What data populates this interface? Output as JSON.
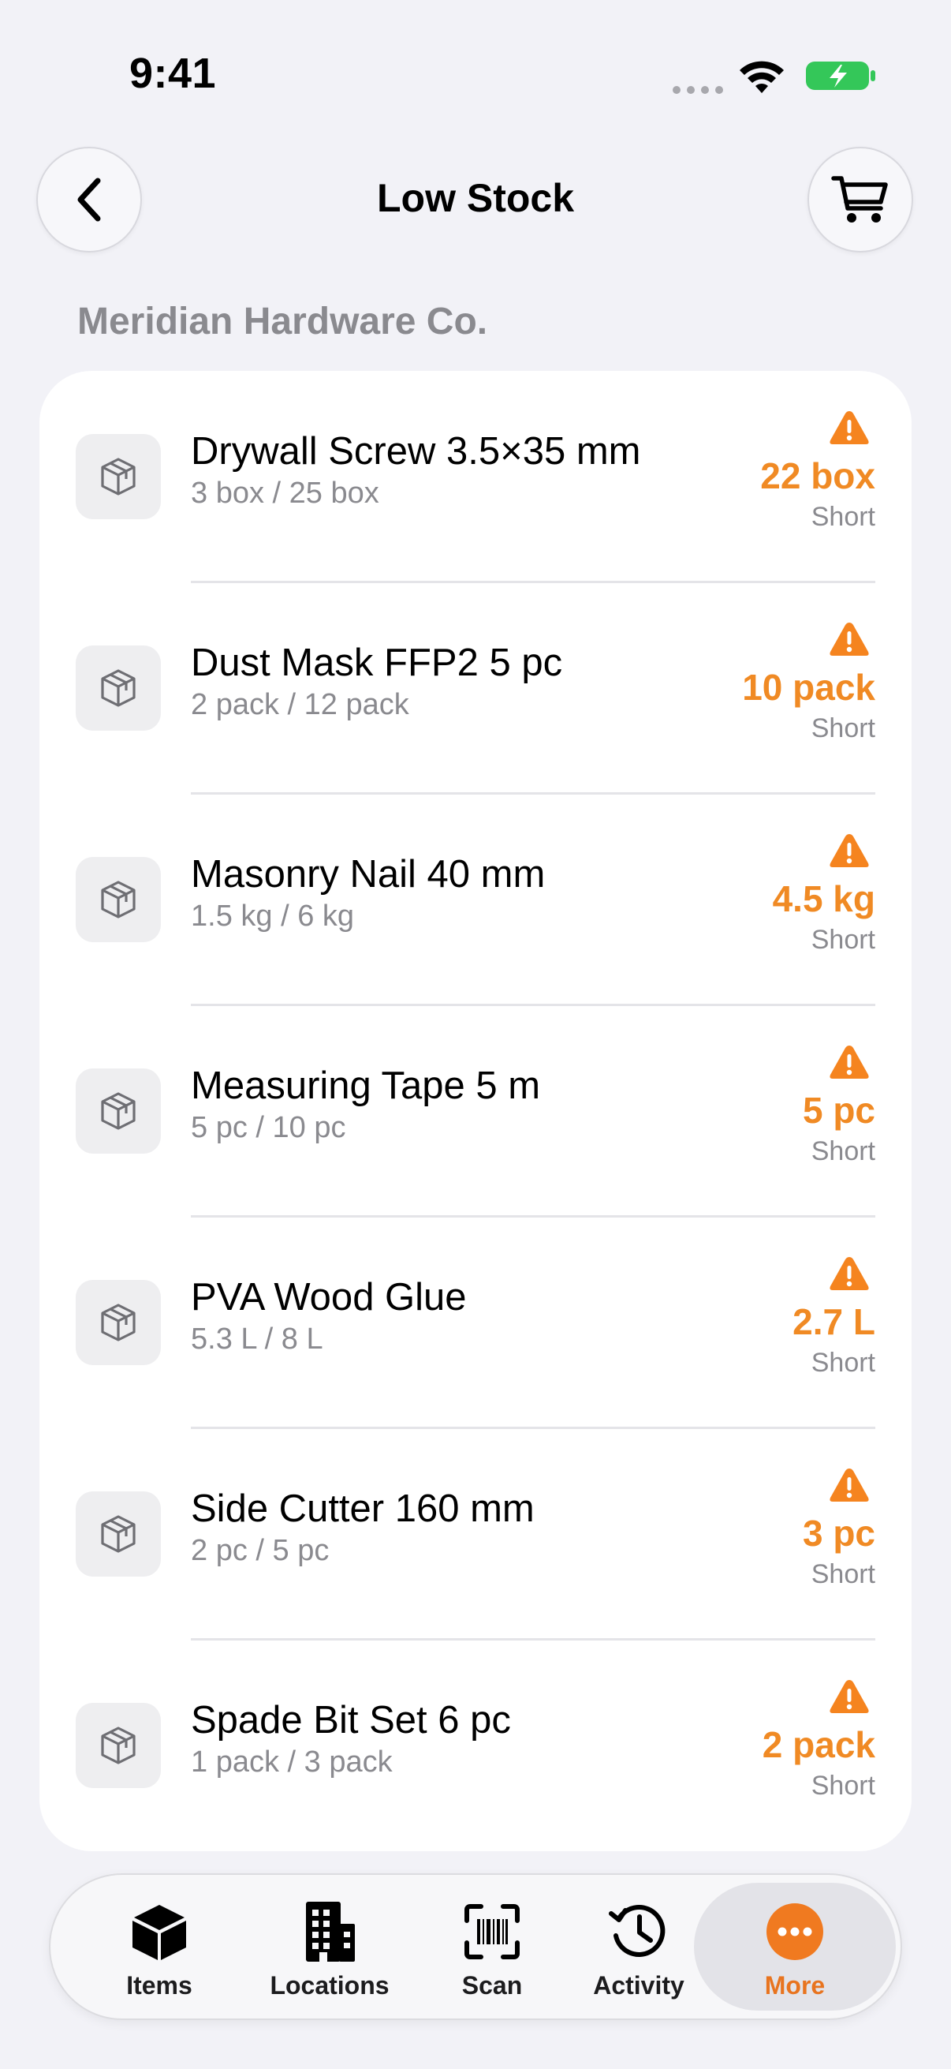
{
  "status_bar": {
    "time": "9:41"
  },
  "nav": {
    "title": "Low Stock",
    "back_icon": "chevron-left-icon",
    "cart_icon": "cart-icon"
  },
  "section": {
    "header": "Meridian Hardware Co."
  },
  "colors": {
    "accent": "#F08A24",
    "warning": "#F5841F",
    "background": "#F2F2F7"
  },
  "items": [
    {
      "name": "Drywall Screw 3.5×35 mm",
      "stock": "3 box / 25 box",
      "shortage": "22 box",
      "status": "Short"
    },
    {
      "name": "Dust Mask FFP2 5 pc",
      "stock": "2 pack / 12 pack",
      "shortage": "10 pack",
      "status": "Short"
    },
    {
      "name": "Masonry Nail 40 mm",
      "stock": "1.5 kg / 6 kg",
      "shortage": "4.5 kg",
      "status": "Short"
    },
    {
      "name": "Measuring Tape 5 m",
      "stock": "5 pc / 10 pc",
      "shortage": "5 pc",
      "status": "Short"
    },
    {
      "name": "PVA Wood Glue",
      "stock": "5.3 L / 8 L",
      "shortage": "2.7 L",
      "status": "Short"
    },
    {
      "name": "Side Cutter 160 mm",
      "stock": "2 pc / 5 pc",
      "shortage": "3 pc",
      "status": "Short"
    },
    {
      "name": "Spade Bit Set 6 pc",
      "stock": "1 pack / 3 pack",
      "shortage": "2 pack",
      "status": "Short"
    }
  ],
  "tab_bar": {
    "tabs": [
      {
        "label": "Items",
        "icon": "cube-icon"
      },
      {
        "label": "Locations",
        "icon": "building-icon"
      },
      {
        "label": "Scan",
        "icon": "barcode-scan-icon"
      },
      {
        "label": "Activity",
        "icon": "history-icon"
      },
      {
        "label": "More",
        "icon": "more-icon",
        "selected": true
      }
    ]
  }
}
